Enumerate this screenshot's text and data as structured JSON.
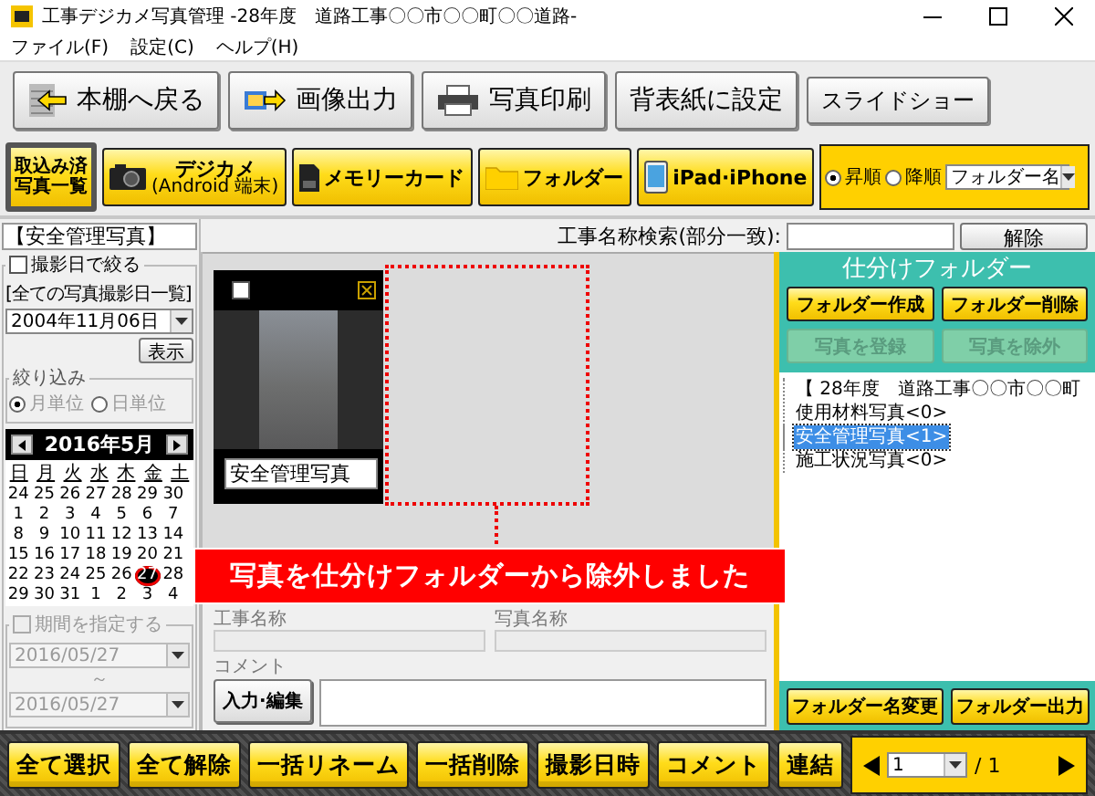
{
  "window": {
    "title": "工事デジカメ写真管理 -28年度　道路工事〇〇市〇〇町〇〇道路-"
  },
  "menu": [
    "ファイル(F)",
    "設定(C)",
    "ヘルプ(H)"
  ],
  "toolbar": [
    {
      "label": "本棚へ戻る",
      "kind": "back"
    },
    {
      "label": "画像出力",
      "kind": "export"
    },
    {
      "label": "写真印刷",
      "kind": "print"
    },
    {
      "label": "背表紙に設定",
      "kind": "plain"
    },
    {
      "label": "スライドショー",
      "kind": "small"
    }
  ],
  "sources": [
    {
      "lines": [
        "取込み済",
        "写真一覧"
      ],
      "kind": "list",
      "selected": true
    },
    {
      "label": "デジカメ",
      "sublabel": "(Android 端末)",
      "kind": "camera",
      "selected": false
    },
    {
      "label": "メモリーカード",
      "kind": "card",
      "selected": false
    },
    {
      "label": "フォルダー",
      "kind": "folder",
      "selected": false
    },
    {
      "label": "iPad·iPhone",
      "kind": "tablet",
      "selected": false
    }
  ],
  "sort": {
    "options": [
      {
        "label": "昇順",
        "selected": true
      },
      {
        "label": "降順",
        "selected": false
      }
    ],
    "field": "フォルダー名"
  },
  "left_panel": {
    "heading": "【安全管理写真】",
    "date_filter": {
      "label": "撮影日で絞る",
      "checked": false
    },
    "date_list_label": "[全ての写真撮影日一覧]",
    "date": "2004年11月06日",
    "show_button": "表示",
    "narrow": {
      "title": "絞り込み",
      "disabled": true,
      "options": [
        {
          "label": "月単位",
          "selected": true
        },
        {
          "label": "日単位",
          "selected": false
        }
      ]
    },
    "calendar": {
      "month": "2016年5月",
      "weekdays": [
        "日",
        "月",
        "火",
        "水",
        "木",
        "金",
        "土"
      ],
      "days": [
        {
          "day": "24",
          "selected": false
        },
        {
          "day": "25",
          "selected": false
        },
        {
          "day": "26",
          "selected": false
        },
        {
          "day": "27",
          "selected": false
        },
        {
          "day": "28",
          "selected": false
        },
        {
          "day": "29",
          "selected": false
        },
        {
          "day": "30",
          "selected": false
        },
        {
          "day": "1",
          "selected": false
        },
        {
          "day": "2",
          "selected": false
        },
        {
          "day": "3",
          "selected": false
        },
        {
          "day": "4",
          "selected": false
        },
        {
          "day": "5",
          "selected": false
        },
        {
          "day": "6",
          "selected": false
        },
        {
          "day": "7",
          "selected": false
        },
        {
          "day": "8",
          "selected": false
        },
        {
          "day": "9",
          "selected": false
        },
        {
          "day": "10",
          "selected": false
        },
        {
          "day": "11",
          "selected": false
        },
        {
          "day": "12",
          "selected": false
        },
        {
          "day": "13",
          "selected": false
        },
        {
          "day": "14",
          "selected": false
        },
        {
          "day": "15",
          "selected": false
        },
        {
          "day": "16",
          "selected": false
        },
        {
          "day": "17",
          "selected": false
        },
        {
          "day": "18",
          "selected": false
        },
        {
          "day": "19",
          "selected": false
        },
        {
          "day": "20",
          "selected": false
        },
        {
          "day": "21",
          "selected": false
        },
        {
          "day": "22",
          "selected": false
        },
        {
          "day": "23",
          "selected": false
        },
        {
          "day": "24",
          "selected": false
        },
        {
          "day": "25",
          "selected": false
        },
        {
          "day": "26",
          "selected": false
        },
        {
          "day": "27",
          "selected": true
        },
        {
          "day": "28",
          "selected": false
        },
        {
          "day": "29",
          "selected": false
        },
        {
          "day": "30",
          "selected": false
        },
        {
          "day": "31",
          "selected": false
        },
        {
          "day": "1",
          "selected": false
        },
        {
          "day": "2",
          "selected": false
        },
        {
          "day": "3",
          "selected": false
        },
        {
          "day": "4",
          "selected": false
        }
      ]
    },
    "period": {
      "label": "期間を指定する",
      "checked": false,
      "disabled": true,
      "from": "2016/05/27",
      "separator": "～",
      "to": "2016/05/27"
    }
  },
  "center": {
    "search": {
      "label": "工事名称検索(部分一致):",
      "button": "解除"
    },
    "photos": [
      {
        "caption": "安全管理写真",
        "checked": false
      }
    ],
    "fields": [
      {
        "label": "工事名称"
      },
      {
        "label": "写真名称"
      }
    ],
    "comment": {
      "label": "コメント",
      "button": "入力·編集"
    }
  },
  "banner": "写真を仕分けフォルダーから除外しました",
  "folders": {
    "title": "仕分けフォルダー",
    "buttons": [
      {
        "label": "フォルダー作成",
        "disabled": false
      },
      {
        "label": "フォルダー削除",
        "disabled": false
      },
      {
        "label": "写真を登録",
        "disabled": true
      },
      {
        "label": "写真を除外",
        "disabled": true
      }
    ],
    "tree": [
      {
        "label": "【 28年度　道路工事〇〇市〇〇町",
        "selected": false,
        "children": [
          {
            "label": "使用材料写真<0>",
            "selected": false
          },
          {
            "label": "安全管理写真<1>",
            "selected": true
          },
          {
            "label": "施工状況写真<0>",
            "selected": false
          }
        ]
      }
    ],
    "footer_buttons": [
      "フォルダー名変更",
      "フォルダー出力"
    ]
  },
  "bottom": {
    "actions": [
      "全て選択",
      "全て解除",
      "一括リネーム",
      "一括削除",
      "撮影日時",
      "コメント",
      "連結"
    ],
    "pager": {
      "page": "1",
      "total": "/ 1"
    }
  }
}
